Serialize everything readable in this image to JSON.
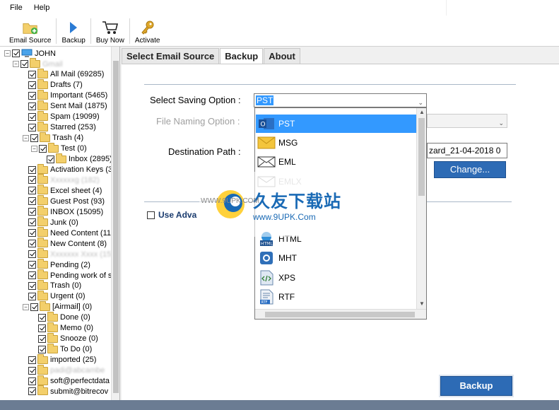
{
  "menu": {
    "file": "File",
    "help": "Help"
  },
  "toolbar": {
    "email_source": "Email Source",
    "backup": "Backup",
    "buy_now": "Buy Now",
    "activate": "Activate"
  },
  "tree": {
    "root": "JOHN",
    "items": [
      "Gmail",
      "All Mail (69285)",
      "Drafts (7)",
      "Important (5465)",
      "Sent Mail (1875)",
      "Spam (19099)",
      "Starred (253)",
      "Trash (4)",
      "Test (0)",
      "Inbox (2895)",
      "Activation Keys (3",
      "Xxxxxxg (182)",
      "Excel sheet (4)",
      "Guest Post (93)",
      "INBOX (15095)",
      "Junk (0)",
      "Need Content (11",
      "New Content (8)",
      "Xxxxxxx Xxxx (15",
      "Pending (2)",
      "Pending work of s",
      "Trash (0)",
      "Urgent (0)",
      "[Airmail] (0)",
      "Done (0)",
      "Memo (0)",
      "Snooze (0)",
      "To Do (0)",
      "imported (25)",
      "padi@abcambe",
      "soft@perfectdata",
      "submit@bitrecov"
    ]
  },
  "tabs": {
    "select_email_source": "Select Email Source",
    "backup": "Backup",
    "about": "About"
  },
  "form": {
    "saving_label": "Select Saving Option :",
    "saving_value": "PST",
    "naming_label": "File Naming Option :",
    "dest_label": "Destination Path :",
    "dest_value": "zard_21-04-2018 0",
    "change_btn": "Change...",
    "use_adv": "Use Adva",
    "backup_btn": "Backup"
  },
  "dropdown": {
    "options": [
      "PST",
      "MSG",
      "EML",
      "EMLX",
      "",
      "",
      "HTML",
      "MHT",
      "XPS",
      "RTF"
    ]
  },
  "watermark": {
    "cn": "久友下载站",
    "url": "www.9UPK.Com",
    "small": "WWW.9UPK.COM"
  },
  "colors": {
    "accent": "#2d6bb5",
    "selection": "#3399ff",
    "status": "#6b7c93"
  }
}
